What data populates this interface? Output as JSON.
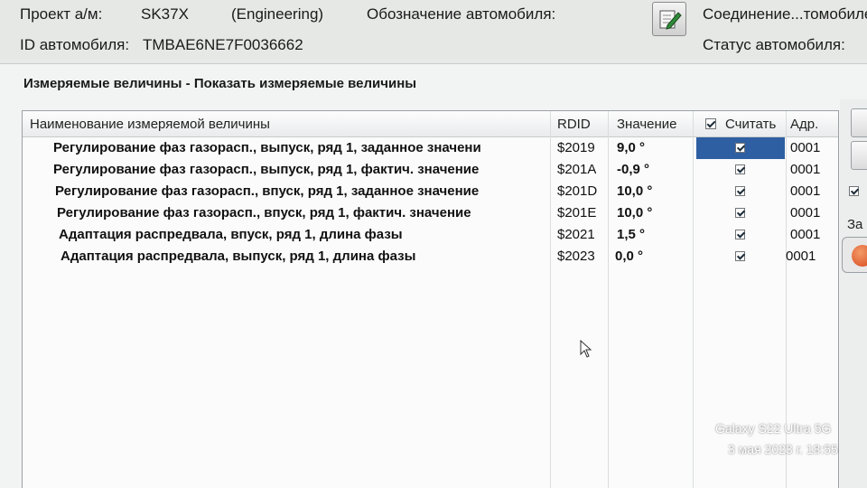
{
  "header": {
    "project_label": "Проект а/м:",
    "project_value": "SK37X",
    "project_mode": "(Engineering)",
    "vehicle_designation_label": "Обозначение автомобиля:",
    "connection_label": "Соединение...томобилем",
    "vehicle_id_label": "ID автомобиля:",
    "vehicle_id_value": "TMBAE6NE7F0036662",
    "vehicle_status_label": "Статус автомобиля:"
  },
  "section": {
    "title": "Измеряемые величины - Показать измеряемые величины"
  },
  "table": {
    "columns": {
      "name": "Наименование измеряемой величины",
      "rdid": "RDID",
      "value": "Значение",
      "read": "Считать",
      "addr": "Адр."
    },
    "rows": [
      {
        "name": "Регулирование фаз газорасп., выпуск, ряд 1, заданное значени",
        "rdid": "$2019",
        "value": "9,0 °",
        "addr": "0001"
      },
      {
        "name": "Регулирование фаз газорасп., выпуск, ряд 1, фактич. значение",
        "rdid": "$201A",
        "value": "-0,9 °",
        "addr": "0001"
      },
      {
        "name": "Регулирование фаз газорасп., впуск, ряд 1, заданное значение",
        "rdid": "$201D",
        "value": "10,0 °",
        "addr": "0001"
      },
      {
        "name": "Регулирование фаз газорасп., впуск, ряд 1, фактич. значение",
        "rdid": "$201E",
        "value": "10,0 °",
        "addr": "0001"
      },
      {
        "name": "Адаптация распредвала, впуск, ряд 1, длина фазы",
        "rdid": "$2021",
        "value": "1,5 °",
        "addr": "0001"
      },
      {
        "name": "Адаптация распредвала, выпуск, ряд 1, длина фазы",
        "rdid": "$2023",
        "value": "0,0 °",
        "addr": "0001"
      }
    ]
  },
  "side": {
    "label": "За"
  },
  "watermark": {
    "device": "Galaxy S22 Ultra 5G",
    "datetime": "3 мая 2023 г. 18:55"
  },
  "colors": {
    "selection": "#2f5fa3",
    "stop_button": "#d8481b"
  }
}
